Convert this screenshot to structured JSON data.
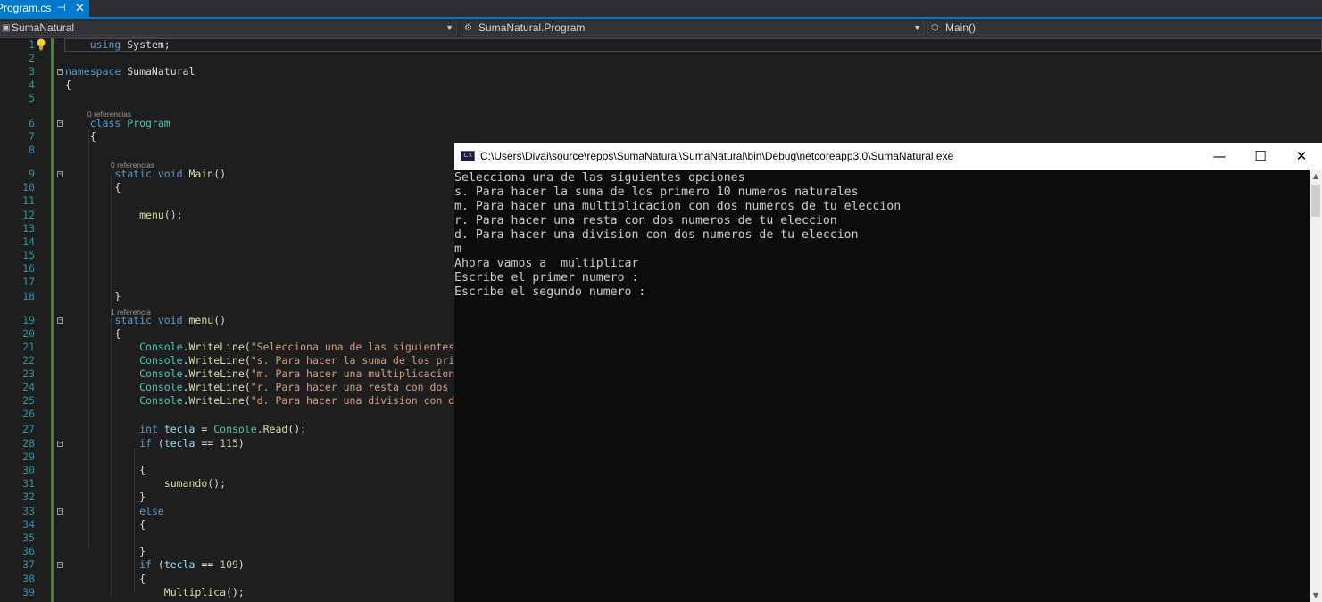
{
  "tab": {
    "label": "Program.cs",
    "pin": "⊣",
    "close": "✕"
  },
  "nav": {
    "project": "SumaNatural",
    "class": "SumaNatural.Program",
    "member": "Main()"
  },
  "editor": {
    "lines": [
      {
        "n": "1",
        "html": "    <span class=\"kw\">using</span> System;"
      },
      {
        "n": "2",
        "html": ""
      },
      {
        "n": "3",
        "html": "<span class=\"kw\">namespace</span> SumaNatural"
      },
      {
        "n": "4",
        "html": "{"
      },
      {
        "n": "5",
        "html": ""
      },
      {
        "n": "6",
        "html": "    <span class=\"kw\">class</span> <span class=\"ty\">Program</span>"
      },
      {
        "n": "7",
        "html": "    {"
      },
      {
        "n": "8",
        "html": ""
      },
      {
        "n": "9",
        "html": "        <span class=\"kw\">static void</span> <span class=\"mt\">Main</span>()"
      },
      {
        "n": "10",
        "html": "        {"
      },
      {
        "n": "11",
        "html": ""
      },
      {
        "n": "12",
        "html": "            <span class=\"mt\">menu</span>();"
      },
      {
        "n": "13",
        "html": ""
      },
      {
        "n": "14",
        "html": ""
      },
      {
        "n": "15",
        "html": ""
      },
      {
        "n": "16",
        "html": ""
      },
      {
        "n": "17",
        "html": ""
      },
      {
        "n": "18",
        "html": "        }"
      },
      {
        "n": "19",
        "html": "        <span class=\"kw\">static void</span> <span class=\"mt\">menu</span>()"
      },
      {
        "n": "20",
        "html": "        {"
      },
      {
        "n": "21",
        "html": "            <span class=\"ty\">Console</span>.<span class=\"mt\">WriteLine</span>(<span class=\"st\">\"Selecciona una de las siguientes opci</span>"
      },
      {
        "n": "22",
        "html": "            <span class=\"ty\">Console</span>.<span class=\"mt\">WriteLine</span>(<span class=\"st\">\"s. Para hacer la suma de los primero </span>"
      },
      {
        "n": "23",
        "html": "            <span class=\"ty\">Console</span>.<span class=\"mt\">WriteLine</span>(<span class=\"st\">\"m. Para hacer una multiplicacion con </span>"
      },
      {
        "n": "24",
        "html": "            <span class=\"ty\">Console</span>.<span class=\"mt\">WriteLine</span>(<span class=\"st\">\"r. Para hacer una resta con dos numer</span>"
      },
      {
        "n": "25",
        "html": "            <span class=\"ty\">Console</span>.<span class=\"mt\">WriteLine</span>(<span class=\"st\">\"d. Para hacer una division con dos nu</span>"
      },
      {
        "n": "26",
        "html": ""
      },
      {
        "n": "27",
        "html": "            <span class=\"kw\">int</span> <span class=\"id\">tecla</span> = <span class=\"ty\">Console</span>.<span class=\"mt\">Read</span>();"
      },
      {
        "n": "28",
        "html": "            <span class=\"kw\">if</span> (<span class=\"id\">tecla</span> == <span class=\"nm\">115</span>)"
      },
      {
        "n": "29",
        "html": ""
      },
      {
        "n": "30",
        "html": "            {"
      },
      {
        "n": "31",
        "html": "                <span class=\"mt\">sumando</span>();"
      },
      {
        "n": "32",
        "html": "            }"
      },
      {
        "n": "33",
        "html": "            <span class=\"kw\">else</span>"
      },
      {
        "n": "34",
        "html": "            {"
      },
      {
        "n": "35",
        "html": ""
      },
      {
        "n": "36",
        "html": "            }"
      },
      {
        "n": "37",
        "html": "            <span class=\"kw\">if</span> (<span class=\"id\">tecla</span> == <span class=\"nm\">109</span>)"
      },
      {
        "n": "38",
        "html": "            {"
      },
      {
        "n": "39",
        "html": "                <span class=\"mt\">Multiplica</span>();"
      }
    ],
    "codelens": [
      "0 referencias",
      "0 referencias",
      "1 referencia"
    ]
  },
  "console": {
    "title": "C:\\Users\\Divai\\source\\repos\\SumaNatural\\SumaNatural\\bin\\Debug\\netcoreapp3.0\\SumaNatural.exe",
    "icon_text": "C:\\",
    "minimize": "—",
    "maximize": "☐",
    "close": "✕",
    "lines": [
      "Selecciona una de las siguientes opciones",
      "s. Para hacer la suma de los primero 10 numeros naturales",
      "m. Para hacer una multiplicacion con dos numeros de tu eleccion",
      "r. Para hacer una resta con dos numeros de tu eleccion",
      "d. Para hacer una division con dos numeros de tu eleccion",
      "m",
      "Ahora vamos a  multiplicar",
      "Escribe el primer numero :",
      "Escribe el segundo numero :"
    ]
  }
}
